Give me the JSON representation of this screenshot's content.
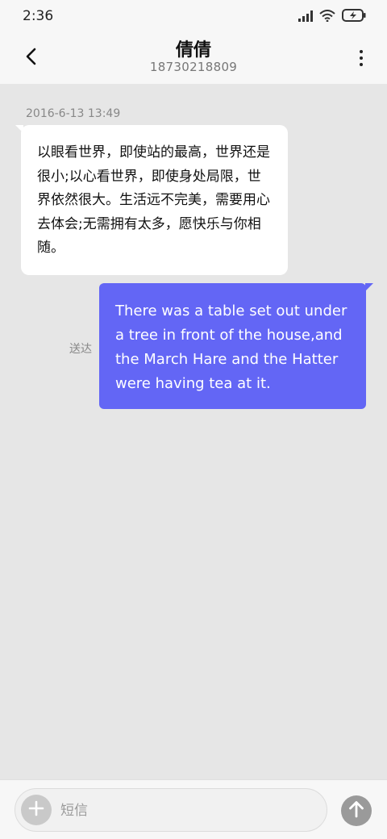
{
  "status_bar": {
    "time": "2:36",
    "icons": [
      "signal-icon",
      "wifi-icon",
      "battery-charging-icon"
    ]
  },
  "header": {
    "contact_name": "倩倩",
    "phone_number": "18730218809",
    "back_icon": "chevron-left-icon",
    "more_icon": "more-vertical-icon"
  },
  "conversation": {
    "timestamp": "2016-6-13 13:49",
    "messages": [
      {
        "direction": "incoming",
        "text": "以眼看世界，即使站的最高，世界还是很小;以心看世界，即使身处局限，世界依然很大。生活远不完美，需要用心去体会;无需拥有太多，愿快乐与你相随。"
      },
      {
        "direction": "outgoing",
        "status": "送达",
        "text": "There was a table set out under a tree in front of the house,and the March Hare and the Hatter were having tea at it."
      }
    ]
  },
  "compose": {
    "placeholder": "短信",
    "add_icon": "plus-icon",
    "send_icon": "arrow-up-icon"
  },
  "colors": {
    "outgoing_bubble": "#6366f5",
    "incoming_bubble": "#ffffff",
    "background": "#e6e6e6"
  }
}
